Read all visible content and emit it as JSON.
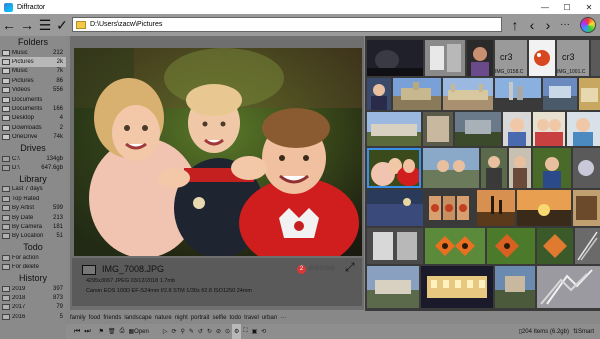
{
  "window": {
    "title": "Diffractor",
    "minimize": "—",
    "maximize": "☐",
    "close": "✕"
  },
  "toolbar": {
    "back": "←",
    "forward": "→",
    "menu": "☰",
    "check": "✓",
    "path": "D:\\Users\\zacw\\Pictures",
    "up": "↑",
    "prev": "‹",
    "next": "›",
    "more": "···"
  },
  "sidebar": {
    "folders_title": "Folders",
    "folders": [
      {
        "label": "Music",
        "count": "212"
      },
      {
        "label": "Pictures",
        "count": "2k"
      },
      {
        "label": "Music",
        "count": "7k"
      },
      {
        "label": "Pictures",
        "count": "86"
      },
      {
        "label": "Videos",
        "count": "556"
      },
      {
        "label": "Documents",
        "count": ""
      },
      {
        "label": "Documents",
        "count": "166"
      },
      {
        "label": "Desktop",
        "count": "4"
      },
      {
        "label": "Downloads",
        "count": "2"
      },
      {
        "label": "OneDrive",
        "count": "74k"
      }
    ],
    "drives_title": "Drives",
    "drives": [
      {
        "label": "C:\\",
        "count": "134gb"
      },
      {
        "label": "D:\\",
        "count": "647.6gb"
      }
    ],
    "library_title": "Library",
    "library": [
      {
        "label": "Last 7 days",
        "count": ""
      },
      {
        "label": "Top Rated",
        "count": ""
      },
      {
        "label": "By Artist",
        "count": "599"
      },
      {
        "label": "By Date",
        "count": "213"
      },
      {
        "label": "By Camera",
        "count": "181"
      },
      {
        "label": "By Location",
        "count": "51"
      }
    ],
    "todo_title": "Todo",
    "todo": [
      {
        "label": "For action",
        "count": ""
      },
      {
        "label": "For delete",
        "count": ""
      }
    ],
    "history_title": "History",
    "history": [
      {
        "label": "2019",
        "count": "397"
      },
      {
        "label": "2018",
        "count": "873"
      },
      {
        "label": "2017",
        "count": "79"
      },
      {
        "label": "2016",
        "count": "5"
      }
    ]
  },
  "preview": {
    "filename": "IMG_7008.JPG",
    "meta": "4295x3067 JPEG 03/12/2018 1.7mb",
    "camera": "Canon EOS 100D EF-S24mm f/2.8 STM 1/30s f/2.8 ISO1250 24mm",
    "rating_badge": "2",
    "stars": "☆☆☆☆☆",
    "expand": "⤢"
  },
  "grid": {
    "cr3_a": "cr3",
    "cr3_a_name": "IMG_0158.C",
    "cr3_b": "cr3",
    "cr3_b_name": "IMG_1001.C"
  },
  "tags": [
    "family",
    "food",
    "friends",
    "landscape",
    "nature",
    "night",
    "portrait",
    "selfie",
    "todo",
    "travel",
    "urban",
    "···"
  ],
  "status": {
    "open": "Open",
    "count": "204 Items (6.2gb)",
    "sort": "Smart"
  },
  "colors": {
    "accent": "#3a8fe8",
    "rating": "#d83838"
  }
}
